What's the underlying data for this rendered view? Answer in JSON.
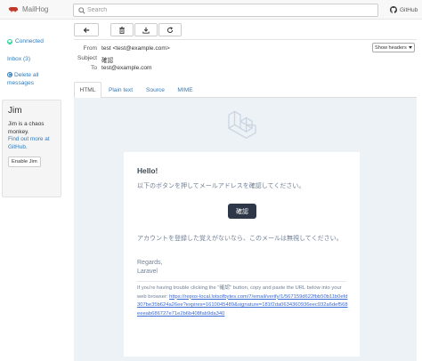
{
  "app": {
    "name": "MailHog",
    "github_label": "GitHub"
  },
  "search": {
    "placeholder": "Search"
  },
  "sidebar": {
    "connected": "Connected",
    "inbox": "Inbox (3)",
    "delete_all": "Delete all messages"
  },
  "jim": {
    "title": "Jim",
    "text": "Jim is a chaos monkey.",
    "link": "Find out more at GitHub.",
    "button": "Enable Jim"
  },
  "toolbar": {
    "buttons": [
      "back-arrow-icon",
      "trash-icon",
      "download-icon",
      "refresh-icon"
    ]
  },
  "headers": {
    "from_label": "From",
    "from_value": "test <test@example.com>",
    "subject_label": "Subject",
    "subject_value": "確認",
    "to_label": "To",
    "to_value": "test@example.com",
    "show_headers": "Show headers"
  },
  "tabs": [
    {
      "label": "HTML",
      "active": true
    },
    {
      "label": "Plain text",
      "active": false
    },
    {
      "label": "Source",
      "active": false
    },
    {
      "label": "MIME",
      "active": false
    }
  ],
  "email": {
    "greeting": "Hello!",
    "line1": "以下のボタンを押してメールアドレスを確認してください。",
    "button": "確認",
    "line2": "アカウントを登録した覚えがないなら、このメールは無視してください。",
    "regards": "Regards,",
    "sender": "Laravel",
    "subcopy_text": "If you're having trouble clicking the \"確認\" button, copy and paste the URL below into your web browser:",
    "subcopy_url": "https://repos-local.lotsofbytes.com/7/email/verify/1/567159d622fbb50b11b0efd307be35b624a26ee?expires=1610045489&signature=181f2da0634360936eec932a6def568eeeab686727e71e2b6b408fab9da340"
  },
  "colors": {
    "navbar_bg": "#f8f8f8",
    "link": "#337ab7",
    "cta_bg": "#2d3748",
    "email_bg": "#edf2f7"
  }
}
